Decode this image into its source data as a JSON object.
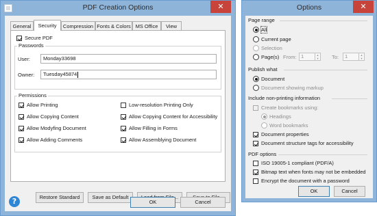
{
  "pdf_dialog": {
    "title": "PDF Creation Options",
    "close_glyph": "✕",
    "tabs": [
      "General",
      "Security",
      "Compression",
      "Fonts & Colors",
      "MS Office",
      "View"
    ],
    "active_tab": "Security",
    "secure_pdf_label": "Secure PDF",
    "passwords": {
      "title": "Passwords",
      "user_label": "User:",
      "user_value": "Monday33698",
      "owner_label": "Owner:",
      "owner_value": "Tuesday45874"
    },
    "permissions": {
      "title": "Permissions",
      "items": [
        {
          "label": "Allow Printing",
          "checked": true
        },
        {
          "label": "Low-resolution Printing Only",
          "checked": false
        },
        {
          "label": "Allow Copying Content",
          "checked": true
        },
        {
          "label": "Allow Copying Content for Accessibility",
          "checked": true
        },
        {
          "label": "Allow Modyfing Document",
          "checked": true
        },
        {
          "label": "Allow Filling in Forms",
          "checked": true
        },
        {
          "label": "Allow Adding Comments",
          "checked": true
        },
        {
          "label": "Allow Assemblying Document",
          "checked": true
        }
      ]
    },
    "buttons": {
      "restore": "Restore Standard",
      "save_default": "Save as Default",
      "load": "Load from File...",
      "save_file": "Save to File...",
      "ok": "OK",
      "cancel": "Cancel"
    },
    "help_glyph": "?"
  },
  "options_dialog": {
    "title": "Options",
    "close_glyph": "✕",
    "page_range": {
      "title": "Page range",
      "all": "All",
      "current_page": "Current page",
      "selection": "Selection",
      "pages": "Page(s)",
      "from_label": "From:",
      "from_value": "1",
      "to_label": "To:",
      "to_value": "1"
    },
    "publish_what": {
      "title": "Publish what",
      "document": "Document",
      "document_markup": "Document showing markup"
    },
    "non_printing": {
      "title": "Include non-printing information",
      "create_bookmarks": "Create bookmarks using:",
      "headings": "Headings",
      "word_bookmarks": "Word bookmarks",
      "doc_properties": "Document properties",
      "doc_structure": "Document structure tags for accessibility"
    },
    "pdf_options": {
      "title": "PDF options",
      "iso": "ISO 19005-1 compliant (PDF/A)",
      "bitmap": "Bitmap text when fonts may not be embedded",
      "encrypt": "Encrypt the document with a password"
    },
    "buttons": {
      "ok": "OK",
      "cancel": "Cancel"
    }
  }
}
